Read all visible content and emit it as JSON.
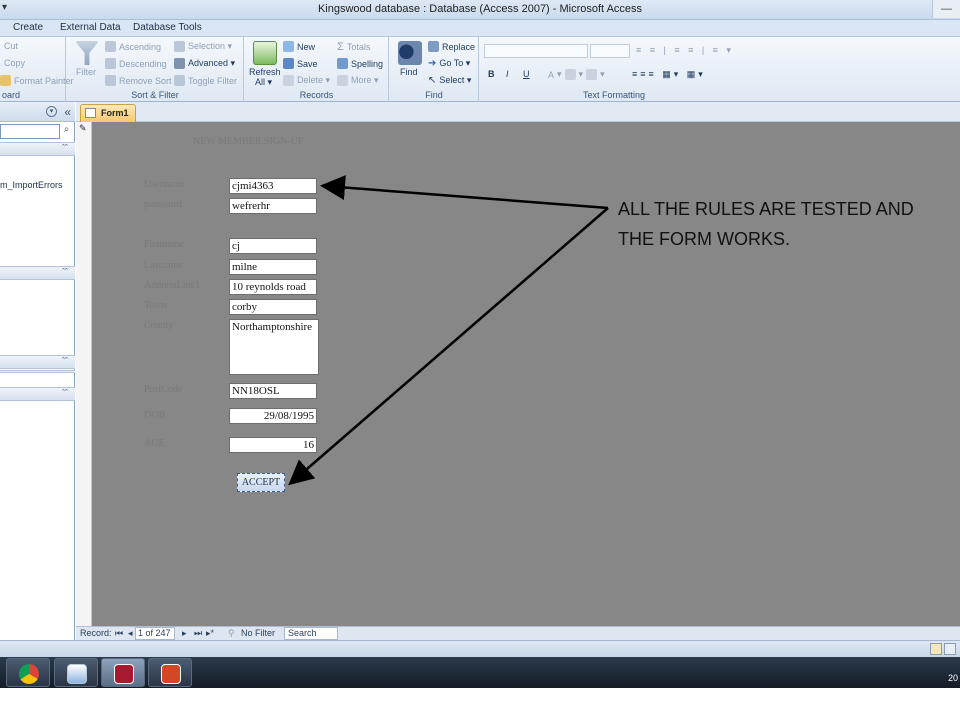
{
  "window": {
    "title": "Kingswood database : Database (Access 2007) - Microsoft Access",
    "quick_access": "▾",
    "control": "—"
  },
  "menu_tabs": [
    "Create",
    "External Data",
    "Database Tools"
  ],
  "ribbon": {
    "clipboard": {
      "cut": "Cut",
      "copy": "Copy",
      "format_painter": "Format Painter",
      "label": "oard"
    },
    "sort_filter": {
      "filter": "Filter",
      "ascending": "Ascending",
      "descending": "Descending",
      "remove_sort": "Remove Sort",
      "selection": "Selection ▾",
      "advanced": "Advanced ▾",
      "toggle_filter": "Toggle Filter",
      "label": "Sort & Filter"
    },
    "records": {
      "refresh": "Refresh",
      "refresh_sub": "All ▾",
      "new": "New",
      "save": "Save",
      "delete": "Delete ▾",
      "totals": "Totals",
      "spelling": "Spelling",
      "more": "More ▾",
      "label": "Records"
    },
    "find": {
      "find": "Find",
      "replace": "Replace",
      "go_to": "Go To ▾",
      "select": "Select ▾",
      "label": "Find"
    },
    "text_formatting": {
      "bold": "B",
      "italic": "I",
      "underline": "U",
      "font_color": "A",
      "label": "Text Formatting"
    }
  },
  "nav_pane": {
    "chevron": "«",
    "search_icon": "⌕",
    "section_toggle": "â",
    "item": "m_ImportErrors"
  },
  "document_tab": {
    "label": "Form1"
  },
  "form": {
    "heading": "NEW MEMBER SIGN-UP",
    "fields": [
      {
        "label": "Username",
        "value": "cjmi4363"
      },
      {
        "label": "password",
        "value": "wefrerhr"
      },
      {
        "label": "Firstname",
        "value": "cj"
      },
      {
        "label": "Lastname",
        "value": "milne"
      },
      {
        "label": "AddressLine1",
        "value": "10 reynolds road"
      },
      {
        "label": "Town",
        "value": "corby"
      },
      {
        "label": "County",
        "value": "Northamptonshire"
      },
      {
        "label": "PostCode",
        "value": "NN18OSL"
      },
      {
        "label": "DOB",
        "value": "29/08/1995"
      },
      {
        "label": "AGE",
        "value": "16"
      }
    ],
    "accept_button": "ACCEPT"
  },
  "annotation": {
    "line1": "ALL THE RULES ARE TESTED AND",
    "line2": "THE FORM WORKS."
  },
  "record_nav": {
    "label": "Record:",
    "first": "⏮",
    "prev": "◂",
    "position": "1 of 247",
    "next": "▸",
    "last": "⏭",
    "new": "▸*",
    "no_filter": "No Filter",
    "search": "Search"
  },
  "taskbar": {
    "apps": [
      "chrome-icon",
      "network-icon",
      "access-icon",
      "powerpoint-icon"
    ],
    "clock": "20"
  },
  "colors": {
    "form_background": "#878787",
    "annotation_arrow": "#000000",
    "chrome": "#4a90d9",
    "access": "#a6192e",
    "powerpoint": "#d24726"
  }
}
